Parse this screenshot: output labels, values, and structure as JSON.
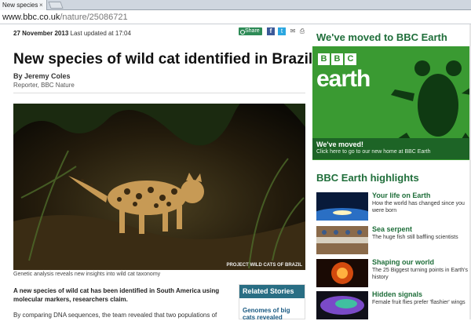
{
  "browser": {
    "tab_title": "New species",
    "tab_close": "×",
    "url_host": "www.bbc.co.uk",
    "url_path": "/nature/25086721"
  },
  "article": {
    "date": "27 November 2013",
    "updated": "Last updated at 17:04",
    "share_label": "Share",
    "headline": "New species of wild cat identified in Brazil",
    "author": "By Jeremy Coles",
    "role": "Reporter, BBC Nature",
    "photo_credit": "PROJECT WILD CATS OF BRAZIL",
    "caption": "Genetic analysis reveals new insights into wild cat taxonomy",
    "lead": "A new species of wild cat has been identified in South America using molecular markers, researchers claim.",
    "body": "By comparing DNA sequences, the team revealed that two populations of"
  },
  "related": {
    "heading": "Related Stories",
    "item": "Genomes of big cats revealed"
  },
  "sidebar": {
    "moved_heading": "We've moved to BBC Earth",
    "bbc_letters": [
      "B",
      "B",
      "C"
    ],
    "earth_word": "earth",
    "moved_title": "We've moved!",
    "moved_sub": "Click here to go to our new home at BBC Earth",
    "highlights_heading": "BBC Earth highlights",
    "highlights": [
      {
        "title": "Your life on Earth",
        "desc": "How the world has changed since you were born"
      },
      {
        "title": "Sea serpent",
        "desc": "The huge fish still baffling scientists"
      },
      {
        "title": "Shaping our world",
        "desc": "The 25 Biggest turning points in Earth's history"
      },
      {
        "title": "Hidden signals",
        "desc": "Female fruit flies prefer 'flashier' wings"
      }
    ]
  },
  "icons": {
    "facebook": "f",
    "twitter": "t",
    "mail": "✉",
    "print": "⎙"
  }
}
